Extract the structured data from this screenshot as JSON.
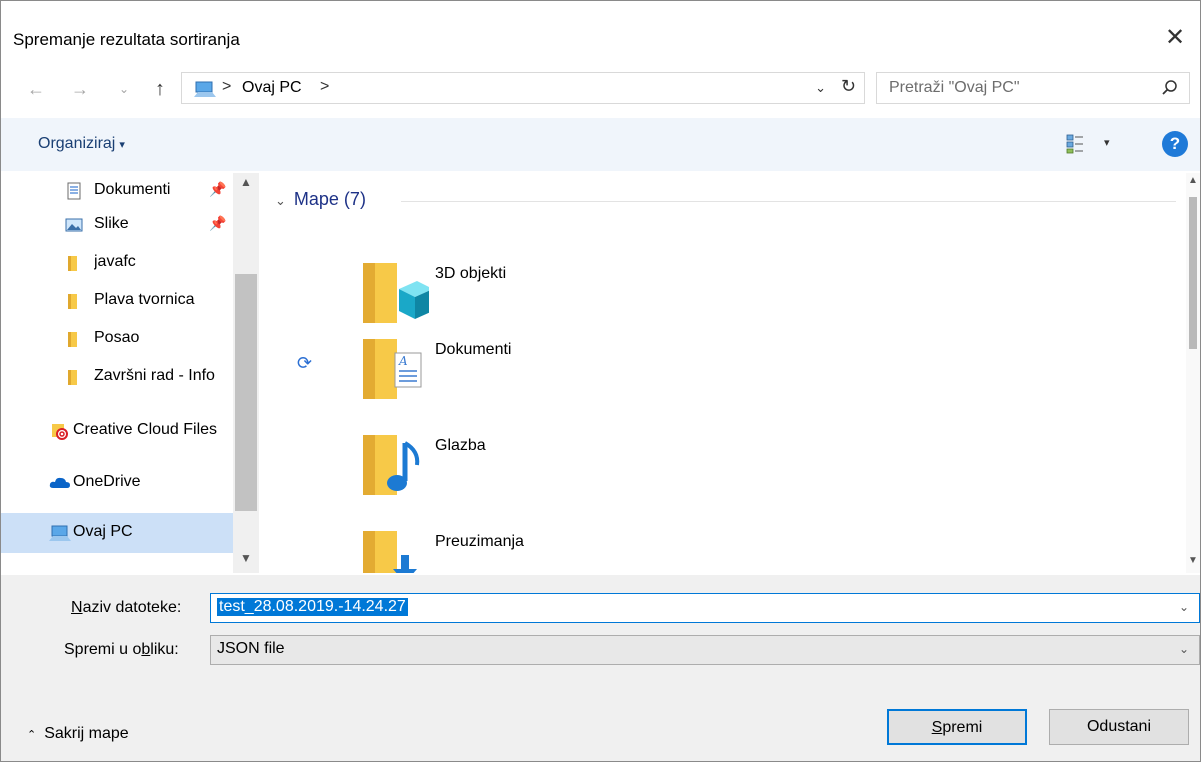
{
  "window": {
    "title": "Spremanje rezultata sortiranja",
    "close_glyph": "✕"
  },
  "address": {
    "location": "Ovaj PC",
    "separator": ">",
    "dropdown_glyph": "⌄",
    "refresh_glyph": "↻",
    "search_placeholder": "Pretraži \"Ovaj PC\""
  },
  "nav_glyphs": {
    "back": "←",
    "forward": "→",
    "recent": "⌄",
    "up": "↑"
  },
  "toolbar": {
    "organize_label": "Organiziraj",
    "organize_caret": "▾",
    "view_caret": "▾",
    "help_label": "?"
  },
  "sidebar": {
    "items": [
      {
        "label": "Dokumenti",
        "icon": "document-icon",
        "pinned": true
      },
      {
        "label": "Slike",
        "icon": "pictures-icon",
        "pinned": true
      },
      {
        "label": "javafc",
        "icon": "folder-icon",
        "pinned": false
      },
      {
        "label": "Plava tvornica",
        "icon": "folder-icon",
        "pinned": false
      },
      {
        "label": "Posao",
        "icon": "folder-icon",
        "pinned": false
      },
      {
        "label": "Završni rad - Info",
        "icon": "folder-icon",
        "pinned": false
      },
      {
        "label": "Creative Cloud Files",
        "icon": "creative-cloud-icon",
        "pinned": false
      },
      {
        "label": "OneDrive",
        "icon": "onedrive-icon",
        "pinned": false
      },
      {
        "label": "Ovaj PC",
        "icon": "pc-icon",
        "pinned": false,
        "selected": true
      }
    ],
    "pin_glyph": "📌"
  },
  "content": {
    "group_header": "Mape (7)",
    "group_chevron": "⌄",
    "folders": [
      {
        "name": "3D objekti",
        "icon": "3d-objects-icon"
      },
      {
        "name": "Dokumenti",
        "icon": "documents-folder-icon"
      },
      {
        "name": "Glazba",
        "icon": "music-folder-icon"
      },
      {
        "name": "Preuzimanja",
        "icon": "downloads-folder-icon"
      }
    ],
    "sync_glyph": "⟳"
  },
  "form": {
    "filename_label_pre": "",
    "filename_label_ul": "N",
    "filename_label_post": "aziv datoteke:",
    "filename_value": "test_28.08.2019.-14.24.27",
    "filetype_label_pre": "Spremi u o",
    "filetype_label_ul": "b",
    "filetype_label_post": "liku:",
    "filetype_value": "JSON file",
    "dropdown_glyph": "⌄",
    "hide_folders_label": "Sakrij mape",
    "hide_folders_caret": "⌃"
  },
  "buttons": {
    "save_ul": "S",
    "save_rest": "premi",
    "cancel": "Odustani"
  },
  "colors": {
    "accent": "#0078d7",
    "folder_yellow": "#f7c948",
    "selected_bg": "#cce0f7"
  }
}
